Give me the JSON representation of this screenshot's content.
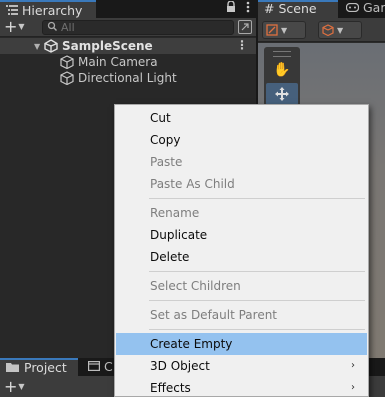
{
  "hierarchy": {
    "tab_label": "Hierarchy",
    "add_label": "+",
    "search_placeholder": "All",
    "scene_name": "SampleScene",
    "objects": [
      {
        "label": "Main Camera"
      },
      {
        "label": "Directional Light"
      }
    ]
  },
  "scene_view": {
    "scene_tab_label": "Scene",
    "game_tab_label": "Gam"
  },
  "bottom_panel": {
    "project_tab_label": "Project",
    "console_tab_label": "C",
    "add_label": "+"
  },
  "context_menu": {
    "items": [
      {
        "label": "Cut",
        "enabled": true
      },
      {
        "label": "Copy",
        "enabled": true
      },
      {
        "label": "Paste",
        "enabled": false
      },
      {
        "label": "Paste As Child",
        "enabled": false
      },
      {
        "label": "Rename",
        "enabled": false
      },
      {
        "label": "Duplicate",
        "enabled": true
      },
      {
        "label": "Delete",
        "enabled": true
      },
      {
        "label": "Select Children",
        "enabled": false
      },
      {
        "label": "Set as Default Parent",
        "enabled": false
      },
      {
        "label": "Create Empty",
        "enabled": true,
        "highlighted": true
      },
      {
        "label": "3D Object",
        "enabled": true,
        "submenu": true
      },
      {
        "label": "Effects",
        "enabled": true,
        "submenu": true
      }
    ],
    "submenu_arrow": "›"
  },
  "colors": {
    "accent": "#3a79bb",
    "menu_highlight": "#94c2ef",
    "panel_bg": "#282828"
  }
}
